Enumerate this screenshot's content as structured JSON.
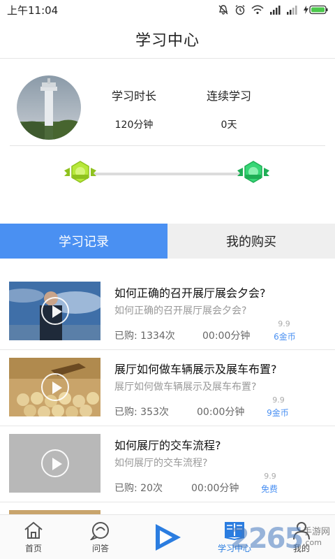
{
  "status_bar": {
    "time": "上午11:04",
    "icons": [
      "mute-icon",
      "alarm-icon",
      "wifi-icon",
      "signal-icon",
      "signal-icon",
      "battery-charging-icon"
    ]
  },
  "header": {
    "title": "学习中心"
  },
  "profile": {
    "stats": [
      {
        "label": "学习时长",
        "value": "120分钟"
      },
      {
        "label": "连续学习",
        "value": "0天"
      }
    ]
  },
  "tabs": [
    {
      "label": "学习记录",
      "active": true
    },
    {
      "label": "我的购买",
      "active": false
    }
  ],
  "courses": [
    {
      "title": "如何正确的召开展厅展会夕会?",
      "subtitle": "如何正确的召开展厅展会夕会?",
      "bought": "已购: 1334次",
      "duration": "00:00分钟",
      "old_price": "9.9",
      "price": "6金币"
    },
    {
      "title": "展厅如何做车辆展示及展车布置?",
      "subtitle": "展厅如何做车辆展示及展车布置?",
      "bought": "已购: 353次",
      "duration": "00:00分钟",
      "old_price": "9.9",
      "price": "9金币"
    },
    {
      "title": "如何展厅的交车流程?",
      "subtitle": "如何展厅的交车流程?",
      "bought": "已购: 20次",
      "duration": "00:00分钟",
      "old_price": "9.9",
      "price": "免费"
    }
  ],
  "bottom_nav": [
    {
      "label": "首页",
      "icon": "home-icon",
      "active": false
    },
    {
      "label": "问答",
      "icon": "qa-icon",
      "active": false
    },
    {
      "label": "",
      "icon": "play-logo-icon",
      "active": false
    },
    {
      "label": "学习中心",
      "icon": "book-icon",
      "active": true
    },
    {
      "label": "我的",
      "icon": "user-icon",
      "active": false
    }
  ],
  "watermark": {
    "number": "2265",
    "site": "手游网",
    "domain": ".com"
  },
  "colors": {
    "accent": "#4a90f2",
    "badge_left": "#a8e02a",
    "badge_right": "#2fd36a"
  }
}
